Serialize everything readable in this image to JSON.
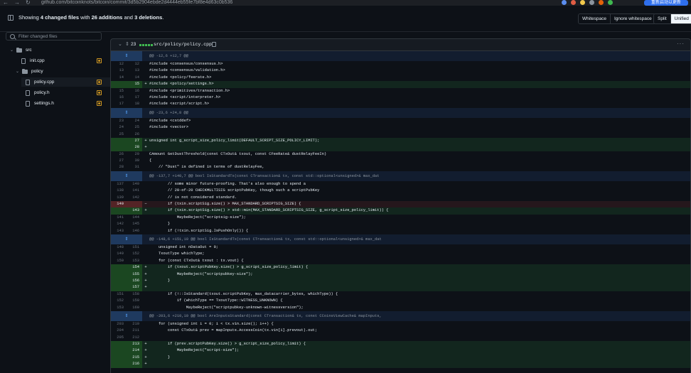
{
  "browser": {
    "url": "github.com/bitcoinknots/bitcoin/commit/3d5b2904ebde2d4444eb55fe7bf8e4d63c0b536",
    "profile": "重新启动以更新"
  },
  "summary": {
    "prefix": "Showing",
    "files": "4 changed files",
    "mid1": "with",
    "additions": "26 additions",
    "mid2": "and",
    "deletions": "3 deletions",
    "end": ".",
    "whitespace_label": "Whitespace",
    "ignore_whitespace_label": "Ignore whitespace",
    "split_label": "Split",
    "unified_label": "Unified",
    "active_view": "Unified"
  },
  "sidebar": {
    "filter_placeholder": "Filter changed files",
    "tree": [
      {
        "type": "folder",
        "label": "src",
        "depth": 0
      },
      {
        "type": "file",
        "label": "init.cpp",
        "depth": 1,
        "status": "modified"
      },
      {
        "type": "folder",
        "label": "policy",
        "depth": 1
      },
      {
        "type": "file",
        "label": "policy.cpp",
        "depth": 2,
        "status": "modified",
        "selected": true
      },
      {
        "type": "file",
        "label": "policy.h",
        "depth": 2,
        "status": "modified"
      },
      {
        "type": "file",
        "label": "settings.h",
        "depth": 2,
        "status": "modified"
      }
    ]
  },
  "file_header": {
    "change_count": "23",
    "file_name": "src/policy/policy.cpp",
    "more_label": "···"
  },
  "diff": [
    {
      "kind": "hunk",
      "text": "@@ -12,6 +12,7 @@"
    },
    {
      "kind": "ctx",
      "old": "12",
      "new": "12",
      "code": "#include <consensus/consensus.h>"
    },
    {
      "kind": "ctx",
      "old": "13",
      "new": "13",
      "code": "#include <consensus/validation.h>"
    },
    {
      "kind": "ctx",
      "old": "14",
      "new": "14",
      "code": "#include <policy/feerate.h>"
    },
    {
      "kind": "add",
      "old": "",
      "new": "15",
      "code": "#include <policy/settings.h>"
    },
    {
      "kind": "ctx",
      "old": "15",
      "new": "16",
      "code": "#include <primitives/transaction.h>"
    },
    {
      "kind": "ctx",
      "old": "16",
      "new": "17",
      "code": "#include <script/interpreter.h>"
    },
    {
      "kind": "ctx",
      "old": "17",
      "new": "18",
      "code": "#include <script/script.h>"
    },
    {
      "kind": "hunk",
      "text": "@@ -23,6 +24,8 @@"
    },
    {
      "kind": "ctx",
      "old": "23",
      "new": "24",
      "code": "#include <cstddef>"
    },
    {
      "kind": "ctx",
      "old": "24",
      "new": "25",
      "code": "#include <vector>"
    },
    {
      "kind": "ctx",
      "old": "25",
      "new": "26",
      "code": ""
    },
    {
      "kind": "add",
      "old": "",
      "new": "27",
      "code": "unsigned int g_script_size_policy_limit(DEFAULT_SCRIPT_SIZE_POLICY_LIMIT);"
    },
    {
      "kind": "add",
      "old": "",
      "new": "28",
      "code": ""
    },
    {
      "kind": "ctx",
      "old": "26",
      "new": "29",
      "code": "CAmount GetDustThreshold(const CTxOut& txout, const CFeeRate& dustRelayFeeIn)"
    },
    {
      "kind": "ctx",
      "old": "27",
      "new": "30",
      "code": "{"
    },
    {
      "kind": "ctx",
      "old": "28",
      "new": "31",
      "code": "    // \"Dust\" is defined in terms of dustRelayFee,"
    },
    {
      "kind": "hunk",
      "text": "@@ -137,7 +140,7 @@ bool IsStandardTx(const CTransaction& tx, const std::optional<unsigned>& max_dat"
    },
    {
      "kind": "ctx",
      "old": "137",
      "new": "140",
      "code": "        // some minor future-proofing. That's also enough to spend a"
    },
    {
      "kind": "ctx",
      "old": "138",
      "new": "141",
      "code": "        // 20-of-20 CHECKMULTISIG scriptPubKey, though such a scriptPubKey"
    },
    {
      "kind": "ctx",
      "old": "139",
      "new": "142",
      "code": "        // is not considered standard."
    },
    {
      "kind": "del",
      "old": "140",
      "new": "",
      "code": "        if (txin.scriptSig.size() > MAX_STANDARD_SCRIPTSIG_SIZE) {"
    },
    {
      "kind": "add",
      "old": "",
      "new": "143",
      "code": "        if (txin.scriptSig.size() > std::min(MAX_STANDARD_SCRIPTSIG_SIZE, g_script_size_policy_limit)) {"
    },
    {
      "kind": "ctx",
      "old": "141",
      "new": "144",
      "code": "            MaybeReject(\"scriptsig-size\");"
    },
    {
      "kind": "ctx",
      "old": "142",
      "new": "145",
      "code": "        }"
    },
    {
      "kind": "ctx",
      "old": "143",
      "new": "146",
      "code": "        if (!txin.scriptSig.IsPushOnly()) {"
    },
    {
      "kind": "hunk",
      "text": "@@ -148,6 +151,10 @@ bool IsStandardTx(const CTransaction& tx, const std::optional<unsigned>& max_dat"
    },
    {
      "kind": "ctx",
      "old": "148",
      "new": "151",
      "code": "    unsigned int nDataOut = 0;"
    },
    {
      "kind": "ctx",
      "old": "149",
      "new": "152",
      "code": "    TxoutType whichType;"
    },
    {
      "kind": "ctx",
      "old": "150",
      "new": "153",
      "code": "    for (const CTxOut& txout : tx.vout) {"
    },
    {
      "kind": "add",
      "old": "",
      "new": "154",
      "code": "        if (txout.scriptPubKey.size() > g_script_size_policy_limit) {"
    },
    {
      "kind": "add",
      "old": "",
      "new": "155",
      "code": "            MaybeReject(\"scriptpubkey-size\");"
    },
    {
      "kind": "add",
      "old": "",
      "new": "156",
      "code": "        }"
    },
    {
      "kind": "add",
      "old": "",
      "new": "157",
      "code": ""
    },
    {
      "kind": "ctx",
      "old": "151",
      "new": "158",
      "code": "        if (!::IsStandard(txout.scriptPubKey, max_datacarrier_bytes, whichType)) {"
    },
    {
      "kind": "ctx",
      "old": "152",
      "new": "159",
      "code": "            if (whichType == TxoutType::WITNESS_UNKNOWN) {"
    },
    {
      "kind": "ctx",
      "old": "153",
      "new": "160",
      "code": "                MaybeReject(\"scriptpubkey-unknown-witnessversion\");"
    },
    {
      "kind": "hunk",
      "text": "@@ -203,6 +210,10 @@ bool AreInputsStandard(const CTransaction& tx, const CCoinsViewCache& mapInputs,"
    },
    {
      "kind": "ctx",
      "old": "203",
      "new": "210",
      "code": "    for (unsigned int i = 0; i < tx.vin.size(); i++) {"
    },
    {
      "kind": "ctx",
      "old": "204",
      "new": "211",
      "code": "        const CTxOut& prev = mapInputs.AccessCoin(tx.vin[i].prevout).out;"
    },
    {
      "kind": "ctx",
      "old": "205",
      "new": "212",
      "code": ""
    },
    {
      "kind": "add",
      "old": "",
      "new": "213",
      "code": "        if (prev.scriptPubKey.size() > g_script_size_policy_limit) {"
    },
    {
      "kind": "add",
      "old": "",
      "new": "214",
      "code": "            MaybeReject(\"script-size\");"
    },
    {
      "kind": "add",
      "old": "",
      "new": "215",
      "code": "        }"
    },
    {
      "kind": "add",
      "old": "",
      "new": "216",
      "code": ""
    }
  ],
  "colors": {
    "add_bg": "#12261e",
    "del_bg": "#25171c",
    "hunk_bg": "#121d2f",
    "accent_green": "#3fb950",
    "modified": "#d29922"
  }
}
